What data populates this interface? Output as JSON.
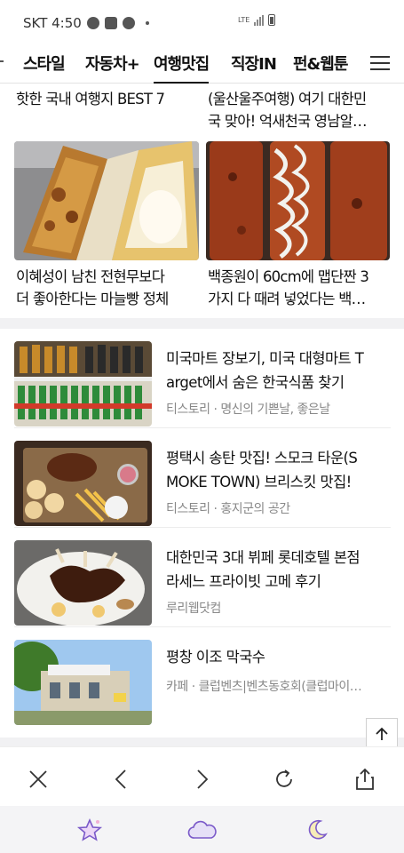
{
  "status_bar": {
    "carrier_time": "SKT 4:50",
    "network": "LTE"
  },
  "tabs": [
    {
      "label": "스타일"
    },
    {
      "label": "자동차+"
    },
    {
      "label": "여행맛집",
      "active": true
    },
    {
      "label": "직장IN"
    },
    {
      "label": "펀&웹툰"
    }
  ],
  "grid": {
    "top_left_caption": "핫한 국내 여행지 BEST 7",
    "top_right_caption_line1": "(울산울주여행) 여기 대한민",
    "top_right_caption_line2": "국 맞아! 억새천국 영남알…",
    "cards": [
      {
        "caption_line1": "이혜성이 남친 전현무보다",
        "caption_line2": "더 좋아한다는 마늘빵 정체",
        "image_icon": "garlic-bread-photo"
      },
      {
        "caption_line1": "백종원이 60cm에 맵단짠 3",
        "caption_line2": "가지 다 때려 넣었다는 백…",
        "image_icon": "skewered-meat-photo"
      }
    ]
  },
  "list": [
    {
      "title_line1": "미국마트 장보기, 미국 대형마트 T",
      "title_line2": "arget에서 숨은 한국식품 찾기",
      "source": "티스토리 · 명신의 기쁜날, 좋은날",
      "image_icon": "store-shelf-photo"
    },
    {
      "title_line1": "평택시 송탄 맛집! 스모크 타운(S",
      "title_line2": "MOKE TOWN) 브리스킷 맛집!",
      "source": "티스토리 · 홍지군의 공간",
      "image_icon": "bbq-platter-photo"
    },
    {
      "title_line1": "대한민국 3대 뷔페 롯데호텔 본점",
      "title_line2": "라세느 프라이빗 고메 후기",
      "source": "루리웹닷컴",
      "image_icon": "lamb-chop-photo"
    },
    {
      "title_line1": "평창 이조 막국수",
      "title_line2": "",
      "source": "카페 · 클럽벤츠|벤츠동호회(클럽마이…",
      "image_icon": "restaurant-exterior-photo"
    }
  ],
  "colors": {
    "separator": "#f1f1f3",
    "source_text": "#888888",
    "bottom_icons": "#7b5ac9"
  }
}
